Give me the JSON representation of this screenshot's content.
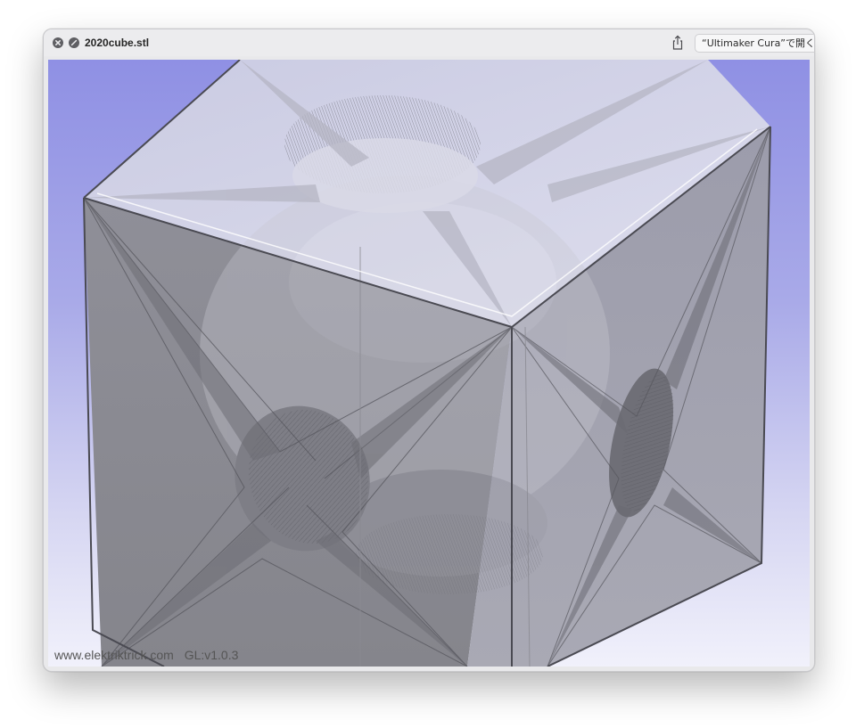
{
  "window": {
    "title": "2020cube.stl",
    "open_with_label": "“Ultimaker Cura”で開く"
  },
  "icons": {
    "close": "close-icon",
    "fullscreen": "fullscreen-icon",
    "share": "share-icon"
  },
  "viewer": {
    "website": "www.elektriktrick.com",
    "version": "GL:v1.0.3"
  },
  "colors": {
    "background_top": "#8f90e4",
    "background_bottom": "#f1f1fb",
    "model_face": "#a7a7ae",
    "model_top": "#d8d8e2"
  }
}
